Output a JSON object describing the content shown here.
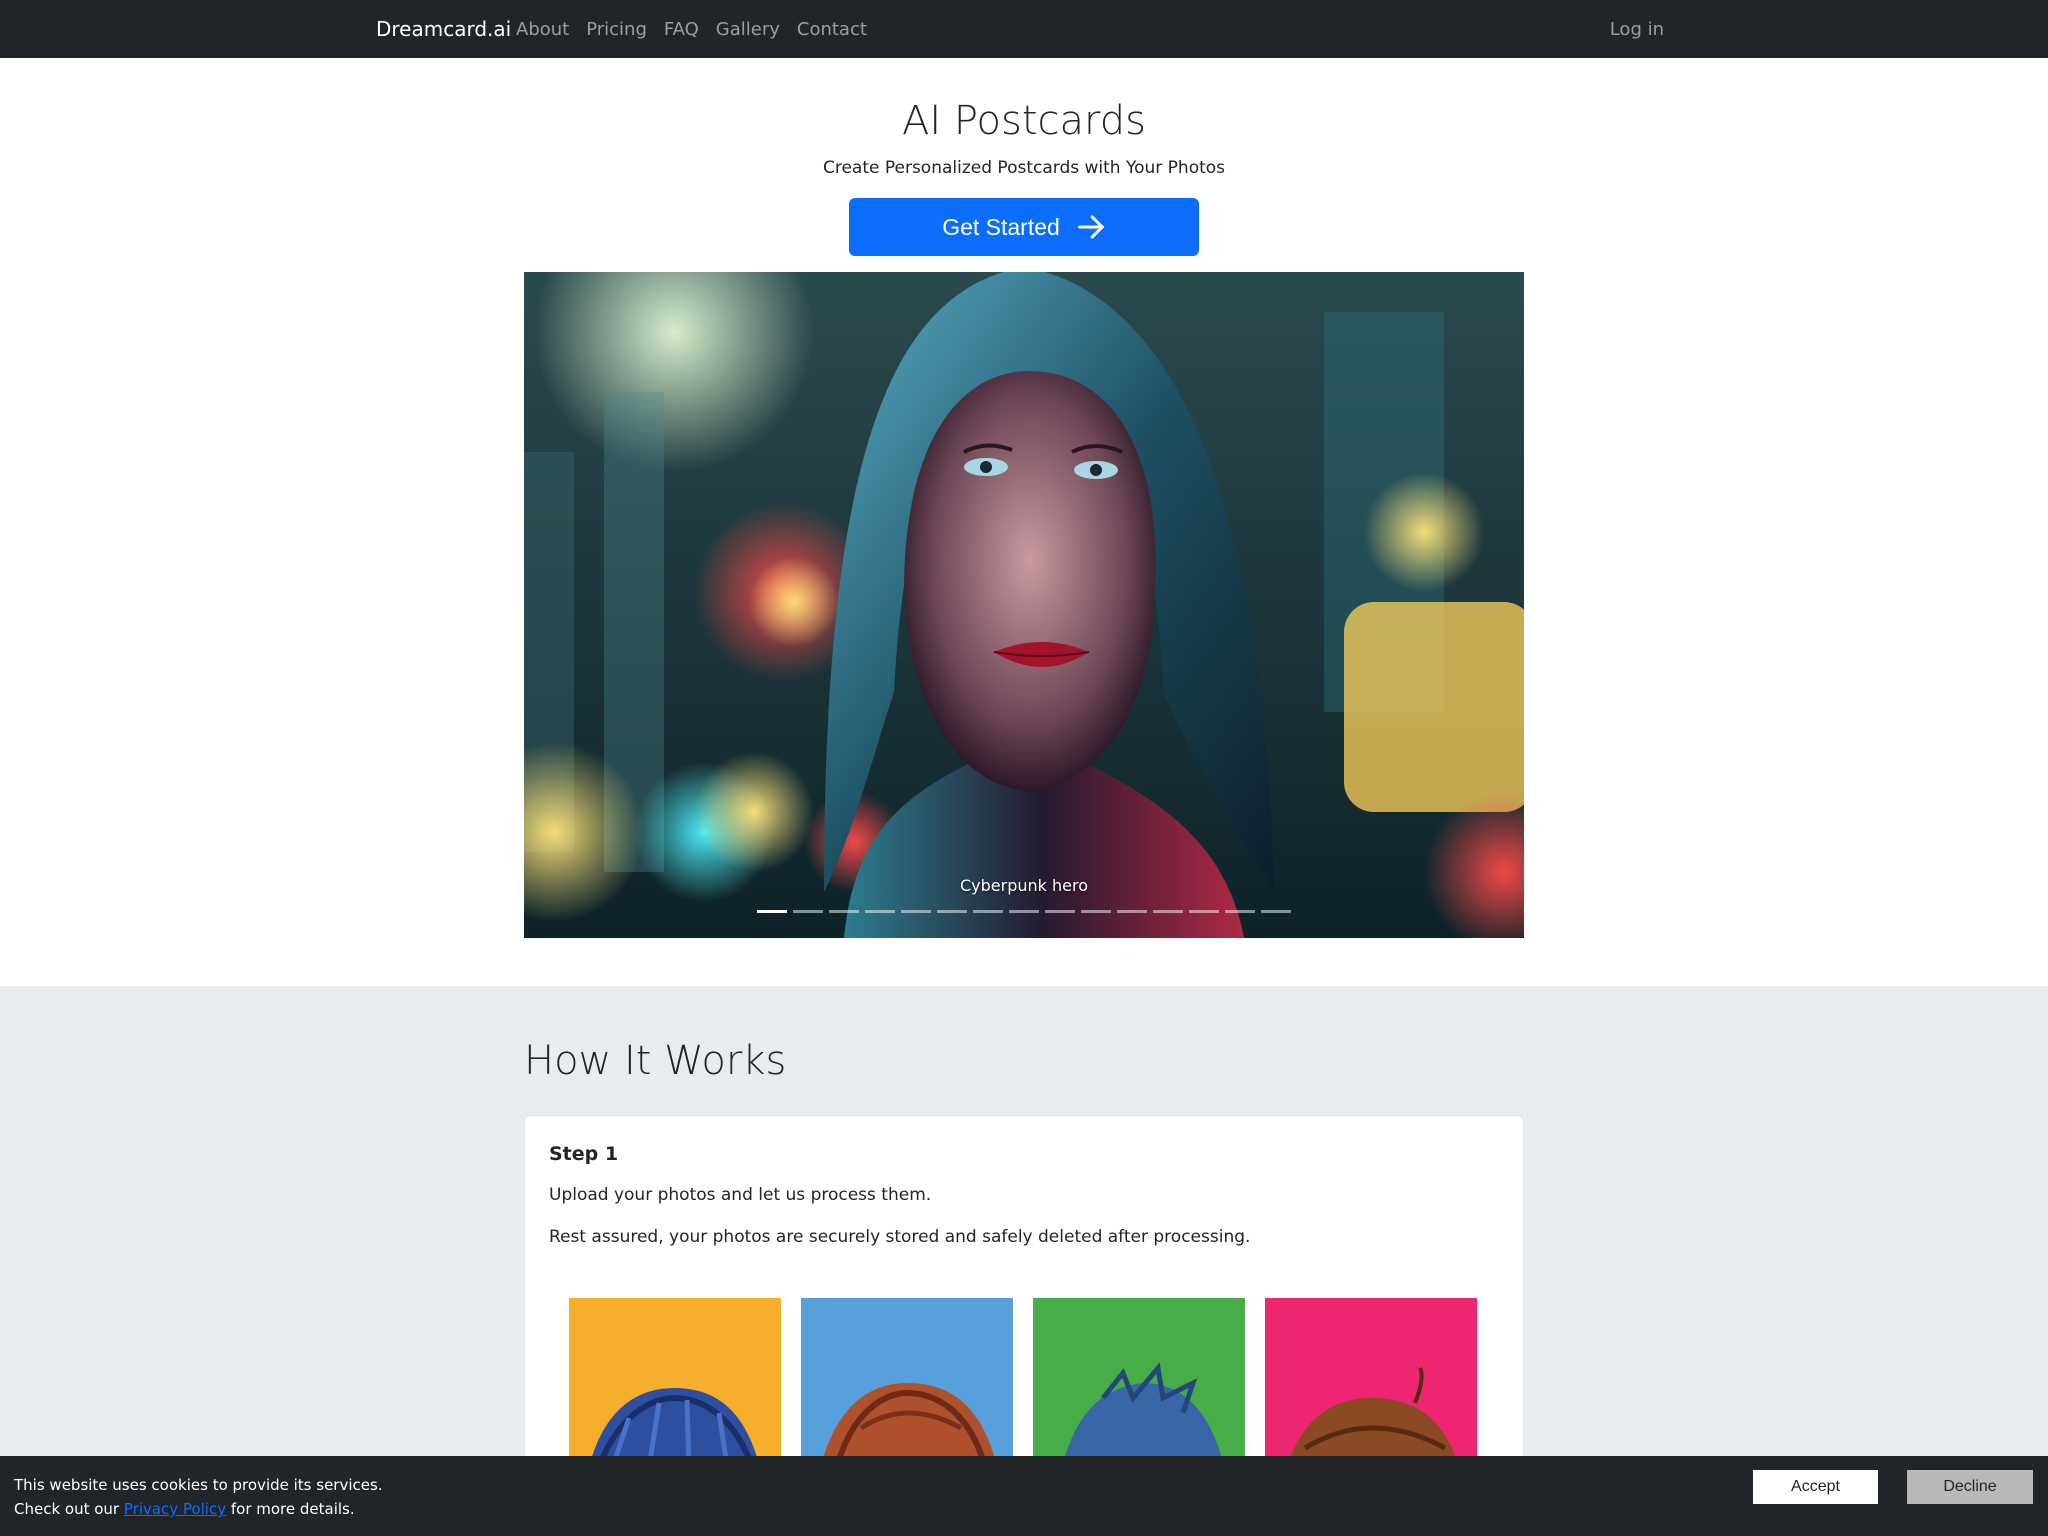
{
  "nav": {
    "brand": "Dreamcard.ai",
    "links": [
      "About",
      "Pricing",
      "FAQ",
      "Gallery",
      "Contact"
    ],
    "login": "Log in"
  },
  "hero": {
    "title": "AI Postcards",
    "subtitle": "Create Personalized Postcards with Your Photos",
    "cta_label": "Get Started",
    "cta_icon": "arrow-right-icon"
  },
  "carousel": {
    "caption": "Cyberpunk hero",
    "slide_count": 15,
    "active_index": 0
  },
  "how_it_works": {
    "title": "How It Works",
    "step": {
      "title": "Step 1",
      "line1": "Upload your photos and let us process them.",
      "line2": "Rest assured, your photos are securely stored and safely deleted after processing."
    },
    "tile_colors": [
      "#f6ae2d",
      "#58a0dc",
      "#46ad48",
      "#ec2670"
    ]
  },
  "cookie": {
    "line1": "This website uses cookies to provide its services.",
    "line2_prefix": "Check out our ",
    "link": "Privacy Policy",
    "line2_suffix": " for more details.",
    "accept": "Accept",
    "decline": "Decline"
  }
}
